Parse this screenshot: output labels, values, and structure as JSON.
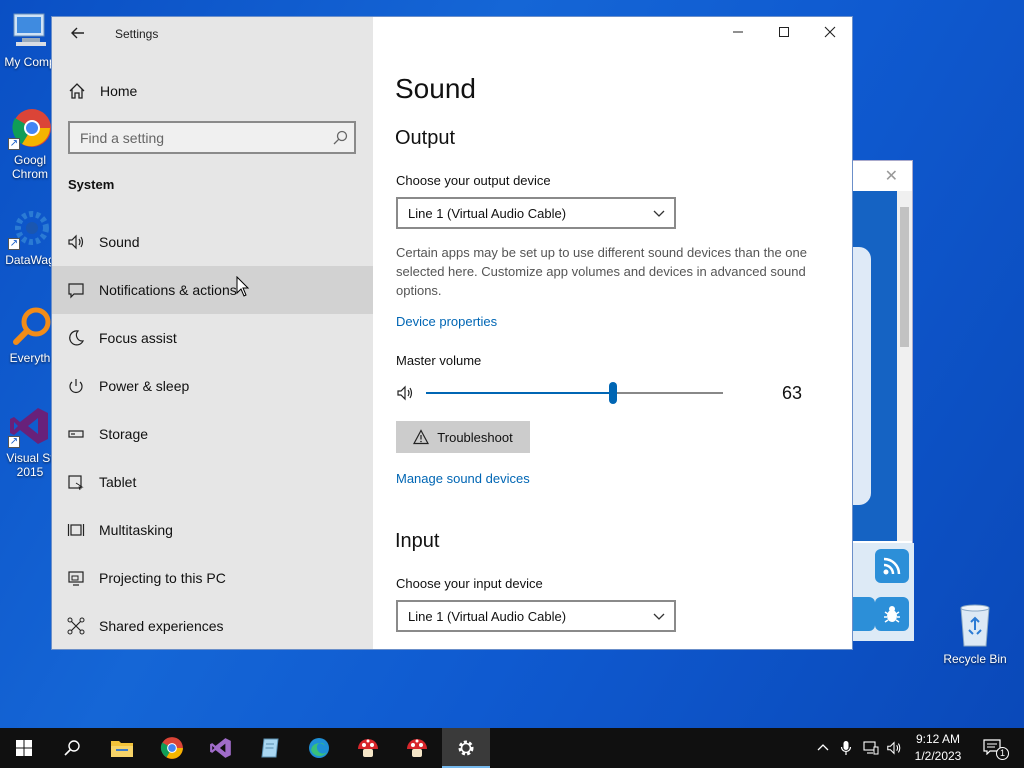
{
  "desktop": {
    "icons": [
      {
        "label": "My Comp"
      },
      {
        "label": "Googl\nChrom"
      },
      {
        "label": "DataWag"
      },
      {
        "label": "Everyth"
      },
      {
        "label": "Visual St\n2015"
      }
    ],
    "recycle_bin": "Recycle Bin"
  },
  "settings": {
    "title": "Settings",
    "home": "Home",
    "search_placeholder": "Find a setting",
    "section": "System",
    "nav_items": [
      {
        "label": "Sound",
        "icon": "speaker-icon"
      },
      {
        "label": "Notifications & actions",
        "icon": "notification-icon"
      },
      {
        "label": "Focus assist",
        "icon": "moon-icon"
      },
      {
        "label": "Power & sleep",
        "icon": "power-icon"
      },
      {
        "label": "Storage",
        "icon": "storage-icon"
      },
      {
        "label": "Tablet",
        "icon": "tablet-icon"
      },
      {
        "label": "Multitasking",
        "icon": "multitasking-icon"
      },
      {
        "label": "Projecting to this PC",
        "icon": "projecting-icon"
      },
      {
        "label": "Shared experiences",
        "icon": "shared-icon"
      }
    ]
  },
  "sound": {
    "page_title": "Sound",
    "output_heading": "Output",
    "output_device_label": "Choose your output device",
    "output_device_value": "Line 1 (Virtual Audio Cable)",
    "description": "Certain apps may be set up to use different sound devices than the one selected here. Customize app volumes and devices in advanced sound options.",
    "device_properties_link": "Device properties",
    "master_volume_label": "Master volume",
    "master_volume_value": "63",
    "master_volume_fraction": 0.63,
    "troubleshoot_label": "Troubleshoot",
    "manage_devices_link": "Manage sound devices",
    "input_heading": "Input",
    "input_device_label": "Choose your input device",
    "input_device_value": "Line 1 (Virtual Audio Cable)"
  },
  "taskbar": {
    "time": "9:12 AM",
    "date": "1/2/2023",
    "notification_count": "1"
  },
  "colors": {
    "accent": "#0066b4",
    "desktop": "#1566d6",
    "taskbar": "#101010"
  }
}
